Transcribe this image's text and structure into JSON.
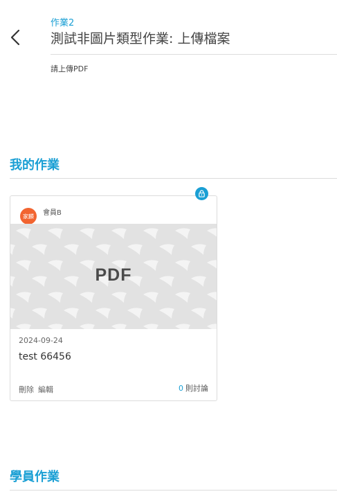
{
  "header": {
    "homework_label": "作業2",
    "homework_title": "測試非圖片類型作業: 上傳檔案",
    "instructions": "請上傳PDF"
  },
  "my_section": {
    "title": "我的作業"
  },
  "card": {
    "avatar_text": "家麟",
    "member_name": "會員B",
    "file_type": "PDF",
    "date": "2024-09-24",
    "description": "test 66456",
    "delete_label": "刪除",
    "edit_label": "編輯",
    "comment_count": "0",
    "comment_label": "則討論"
  },
  "students_section": {
    "title": "學員作業"
  },
  "colors": {
    "accent": "#1a9fd4",
    "avatar": "#f26430"
  }
}
